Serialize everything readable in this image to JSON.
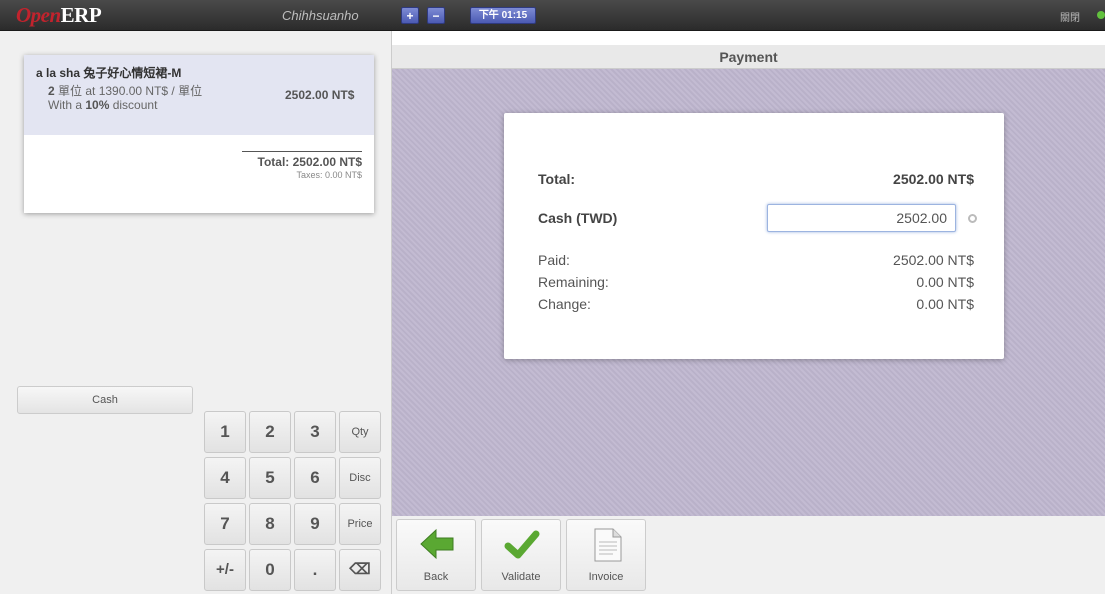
{
  "topbar": {
    "logo_open": "Open",
    "logo_erp": "ERP",
    "username": "Chihhsuanho",
    "plus": "+",
    "minus": "−",
    "time": "下午 01:15",
    "close": "關閉"
  },
  "order": {
    "product_name": "a la sha 兔子好心情短裙-M",
    "qty": "2",
    "unit_text": " 單位 at 1390.00 NT$ / 單位",
    "discount_prefix": "With a ",
    "discount_value": "10%",
    "discount_suffix": " discount",
    "line_total": "2502.00 NT$",
    "total": "Total: 2502.00 NT$",
    "taxes": "Taxes: 0.00 NT$"
  },
  "paymode_button": "Cash",
  "numpad": [
    "1",
    "2",
    "3",
    "Qty",
    "4",
    "5",
    "6",
    "Disc",
    "7",
    "8",
    "9",
    "Price",
    "+/-",
    "0",
    ".",
    "⌫"
  ],
  "payment": {
    "header": "Payment",
    "total_label": "Total:",
    "total_value": "2502.00 NT$",
    "cash_label": "Cash (TWD)",
    "cash_value": "2502.00",
    "paid_label": "Paid:",
    "paid_value": "2502.00 NT$",
    "remaining_label": "Remaining:",
    "remaining_value": "0.00 NT$",
    "change_label": "Change:",
    "change_value": "0.00 NT$"
  },
  "actions": {
    "back": "Back",
    "validate": "Validate",
    "invoice": "Invoice"
  }
}
